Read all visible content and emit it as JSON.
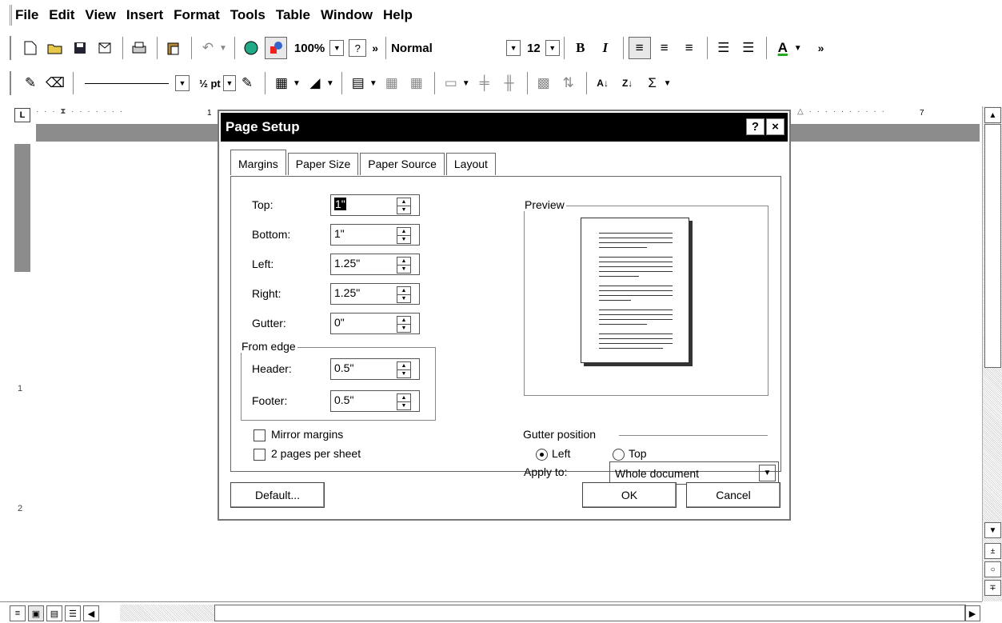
{
  "menu": [
    "File",
    "Edit",
    "View",
    "Insert",
    "Format",
    "Tools",
    "Table",
    "Window",
    "Help"
  ],
  "toolbar": {
    "zoom": "100%",
    "style": "Normal",
    "font_size": "12",
    "bold": "B",
    "italic": "I",
    "font_color_glyph": "A",
    "line_weight": "½ pt",
    "sum_glyph": "Σ"
  },
  "ruler": {
    "mark_1": "1",
    "mark_7": "7",
    "left_mark_1": "1",
    "left_mark_2": "2"
  },
  "dialog": {
    "title": "Page Setup",
    "help_button": "?",
    "close_button": "×",
    "tabs": [
      "Margins",
      "Paper Size",
      "Paper Source",
      "Layout"
    ],
    "active_tab": "Margins",
    "margins": {
      "top_label": "Top:",
      "top_value": "1\"",
      "bottom_label": "Bottom:",
      "bottom_value": "1\"",
      "left_label": "Left:",
      "left_value": "1.25\"",
      "right_label": "Right:",
      "right_value": "1.25\"",
      "gutter_label": "Gutter:",
      "gutter_value": "0\""
    },
    "from_edge": {
      "legend": "From edge",
      "header_label": "Header:",
      "header_value": "0.5\"",
      "footer_label": "Footer:",
      "footer_value": "0.5\""
    },
    "mirror_margins": "Mirror margins",
    "two_pages": "2 pages per sheet",
    "preview_label": "Preview",
    "apply_to_label": "Apply to:",
    "apply_to_value": "Whole document",
    "gutter_position_label": "Gutter position",
    "gutter_left": "Left",
    "gutter_top": "Top",
    "default_button": "Default...",
    "ok_button": "OK",
    "cancel_button": "Cancel"
  }
}
